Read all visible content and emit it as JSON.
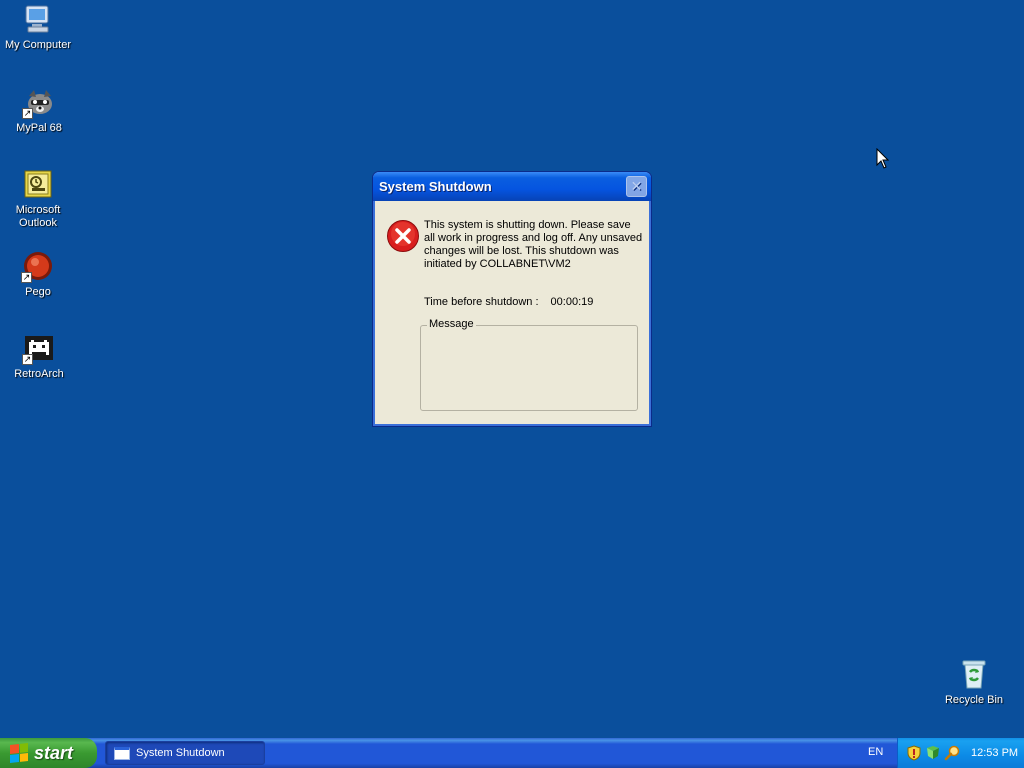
{
  "desktop": {
    "icons": [
      {
        "label": "My Computer"
      },
      {
        "label": "MyPal 68"
      },
      {
        "label": "Microsoft Outlook"
      },
      {
        "label": "Pego"
      },
      {
        "label": "RetroArch"
      },
      {
        "label": "Recycle Bin"
      }
    ]
  },
  "dialog": {
    "title": "System Shutdown",
    "message": "This system is shutting down. Please save all work in progress and log off. Any unsaved changes will be lost. This shutdown was initiated by COLLABNET\\VM2",
    "timer_label": "Time before shutdown :",
    "timer_value": "00:00:19",
    "message_group_label": "Message",
    "close_symbol": "✕"
  },
  "taskbar": {
    "start_label": "start",
    "tasks": [
      {
        "label": "System Shutdown"
      }
    ],
    "language": "EN",
    "clock": "12:53 PM"
  },
  "colors": {
    "desktop": "#0a4f9c",
    "titlebar": "#0554e0",
    "error_red": "#d81e1e"
  }
}
